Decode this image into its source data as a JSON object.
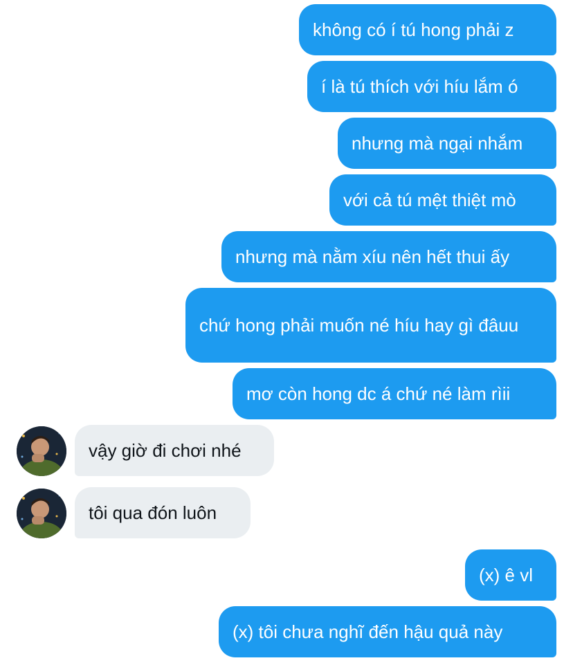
{
  "messages": [
    {
      "side": "sent",
      "text": "không có í tú hong phải z"
    },
    {
      "side": "sent",
      "text": "í là tú thích với híu lắm ó"
    },
    {
      "side": "sent",
      "text": "nhưng mà ngại nhắm"
    },
    {
      "side": "sent",
      "text": "với cả tú mệt thiệt mò"
    },
    {
      "side": "sent",
      "text": "nhưng mà nằm xíu nên hết thui ấy"
    },
    {
      "side": "sent",
      "text": "chứ hong phải muốn né híu hay gì đâuu"
    },
    {
      "side": "sent",
      "text": "mơ còn hong dc á chứ né làm rìii"
    },
    {
      "side": "received",
      "text": "vậy giờ đi chơi nhé"
    },
    {
      "side": "received",
      "text": "tôi qua đón luôn"
    },
    {
      "side": "sent",
      "text": "(x) ê vl"
    },
    {
      "side": "sent",
      "text": "(x) tôi chưa nghĩ đến hậu quả này"
    }
  ],
  "colors": {
    "sent_bubble": "#1d9bf0",
    "received_bubble": "#eaeef1",
    "sent_text": "#ffffff",
    "received_text": "#0f1419"
  }
}
